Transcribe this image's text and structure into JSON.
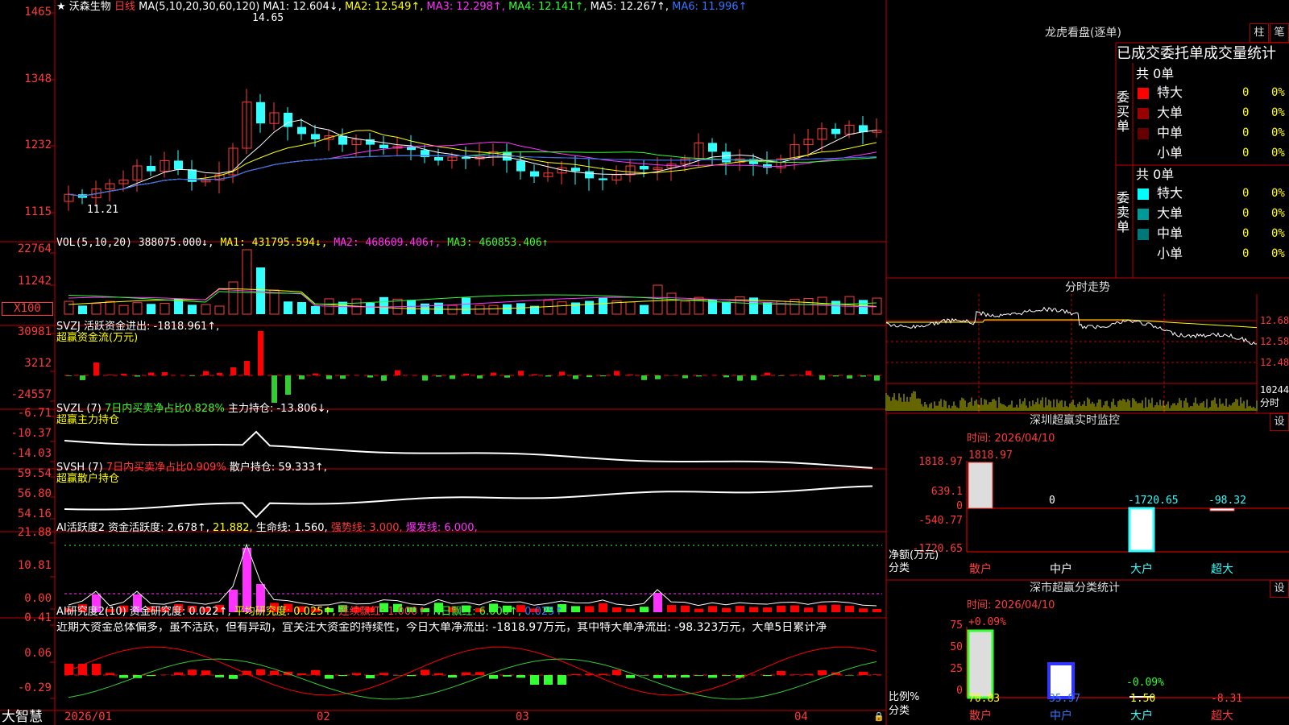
{
  "header": {
    "star": "★",
    "stock_name": "沃森生物",
    "period": "日线",
    "ma_def": "MA(5,10,20,30,60,120)",
    "ma1": "MA1: 12.604↓,",
    "ma2": "MA2: 12.549↑,",
    "ma3": "MA3: 12.298↑,",
    "ma4": "MA4: 12.141↑,",
    "ma5": "MA5: 12.267↑,",
    "ma6": "MA6: 11.996↑"
  },
  "price_axis": [
    "1465",
    "1348",
    "1232",
    "1115"
  ],
  "price_marks": {
    "high": "14.65",
    "low": "11.21"
  },
  "vol": {
    "def": "VOL(5,10,20)",
    "value": "388075.000↓,",
    "ma1": "MA1: 431795.594↓,",
    "ma2": "MA2: 468609.406↑,",
    "ma3": "MA3: 460853.406↑",
    "axis": [
      "22764",
      "11242"
    ],
    "unit": "X100"
  },
  "svzj": {
    "def": "SVZJ",
    "label": "活跃资金进出: -1818.961↑,",
    "title": "超赢资金流(万元)",
    "axis": [
      "30981",
      "3212",
      "-24557"
    ]
  },
  "svzl": {
    "def": "SVZL (7)",
    "ratio": "7日内买卖净占比0.828%",
    "label": "主力持仓: -13.806↓,",
    "title": "超赢主力持仓",
    "axis": [
      "-6.71",
      "-10.37",
      "-14.03"
    ]
  },
  "svsh": {
    "def": "SVSH (7)",
    "ratio": "7日内买卖净占比0.909%",
    "label": "散户持仓: 59.333↑,",
    "title": "超赢散户持仓",
    "axis": [
      "59.54",
      "56.80",
      "54.16"
    ]
  },
  "ai_active": {
    "def": "AI活跃度2",
    "label": "资金活跃度: 2.678↑,",
    "v2": "21.882,",
    "life": "生命线: 1.560,",
    "strong": "强势线: 3.000,",
    "burst": "爆发线: 6.000,",
    "axis": [
      "21.88",
      "10.81",
      "0.00"
    ]
  },
  "ai_research": {
    "def": "AI研究度2(10)",
    "label": "资金研究度: 0.022↑,",
    "avg": "平均研究度: 0.025↑,",
    "cont": "连续飘红: 1.000↑,",
    "n": "N日飘红: 6.000↑,",
    "last": "0.025↑",
    "comment": "近期大资金总体偏多，虽不活跃，但有异动，宜关注大资金的持续性，今日大单净流出: -1818.97万元，其中特大单净流出: -98.323万元，大单5日累计净",
    "axis": [
      "0.41",
      "0.06",
      "-0.29"
    ]
  },
  "bottom_bar": {
    "brand": "大智慧",
    "dates": [
      "2026/01",
      "02",
      "03",
      "04"
    ]
  },
  "dragon": {
    "title": "龙虎看盘(逐单)",
    "btn1": "柱",
    "btn2": "笔",
    "header": "已成交委托单成交量统计",
    "buy_total": "共 0单",
    "sell_total": "共 0单",
    "buy_label": "委买单",
    "sell_label": "委卖单",
    "buy_rows": [
      {
        "name": "特大",
        "count": "0",
        "pct": "0%",
        "color": "#ff0000"
      },
      {
        "name": "大单",
        "count": "0",
        "pct": "0%",
        "color": "#990000"
      },
      {
        "name": "中单",
        "count": "0",
        "pct": "0%",
        "color": "#660000"
      },
      {
        "name": "小单",
        "count": "0",
        "pct": "0%",
        "color": "#000000"
      }
    ],
    "sell_rows": [
      {
        "name": "特大",
        "count": "0",
        "pct": "0%",
        "color": "#00ffff"
      },
      {
        "name": "大单",
        "count": "0",
        "pct": "0%",
        "color": "#009999"
      },
      {
        "name": "中单",
        "count": "0",
        "pct": "0%",
        "color": "#007777"
      },
      {
        "name": "小单",
        "count": "0",
        "pct": "0%",
        "color": "#000000"
      }
    ]
  },
  "intraday": {
    "title": "分时走势",
    "axis": [
      "12.68",
      "12.58",
      "12.48"
    ],
    "vol_label": "10244",
    "vol_unit": "分时"
  },
  "sz_monitor": {
    "title": "深圳超赢实时监控",
    "btn": "设",
    "time": "时间: 2026/04/10",
    "axis": [
      "1818.97",
      "639.1",
      "0",
      "-540.77",
      "-1720.65"
    ],
    "ylabel": "净额(万元)",
    "xlabel": "分类",
    "bars": [
      {
        "name": "散户",
        "value": "1818.97"
      },
      {
        "name": "中户",
        "value": "0"
      },
      {
        "name": "大户",
        "value": "-1720.65"
      },
      {
        "name": "超大",
        "value": "-98.32"
      }
    ]
  },
  "sz_class": {
    "title": "深市超赢分类统计",
    "btn": "设",
    "time": "时间: 2026/04/10",
    "axis": [
      "75",
      "50",
      "25",
      "0"
    ],
    "ylabel": "比例%",
    "xlabel": "分类",
    "top_labels": [
      "+0.09%",
      "-0.09%"
    ],
    "bars": [
      {
        "name": "散户",
        "value": "70.83"
      },
      {
        "name": "中户",
        "value": "35.97"
      },
      {
        "name": "大户",
        "value": "1.50"
      },
      {
        "name": "超大",
        "value": "-8.31"
      }
    ]
  }
}
